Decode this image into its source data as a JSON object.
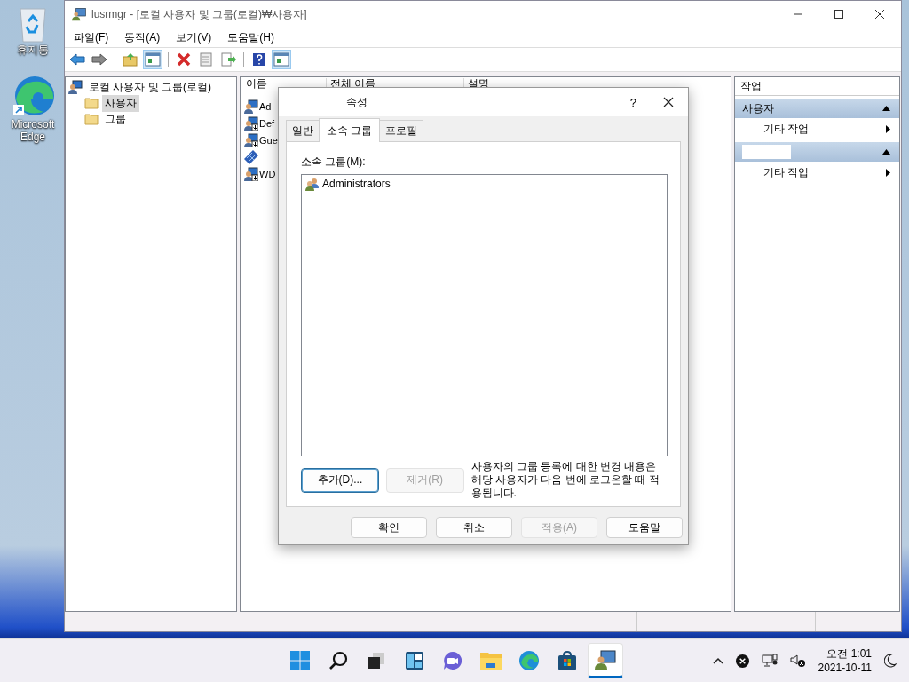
{
  "desktop": {
    "icons": [
      {
        "kind": "recycle",
        "label": "휴지통"
      },
      {
        "kind": "edge",
        "label": "Microsoft Edge"
      }
    ]
  },
  "window": {
    "title": "lusrmgr - [로컬 사용자 및 그룹(로컬)₩사용자]",
    "menu": [
      "파일(F)",
      "동작(A)",
      "보기(V)",
      "도움말(H)"
    ],
    "toolbar": [
      {
        "kind": "back",
        "pressed": false
      },
      {
        "kind": "forward",
        "pressed": false
      },
      {
        "kind": "separator"
      },
      {
        "kind": "up",
        "pressed": false
      },
      {
        "kind": "tree",
        "pressed": true
      },
      {
        "kind": "separator"
      },
      {
        "kind": "delete",
        "pressed": false
      },
      {
        "kind": "properties",
        "pressed": false
      },
      {
        "kind": "export",
        "pressed": false
      },
      {
        "kind": "separator"
      },
      {
        "kind": "help",
        "pressed": false
      },
      {
        "kind": "actionpane",
        "pressed": true
      }
    ],
    "tree": {
      "label": "로컬 사용자 및 그룹(로컬)",
      "children": [
        {
          "label": "사용자",
          "selected": true
        },
        {
          "label": "그룹",
          "selected": false
        }
      ]
    },
    "list": {
      "columns": [
        "이름",
        "전체 이름",
        "설명"
      ],
      "rows": [
        {
          "kind": "user",
          "name": "Ad"
        },
        {
          "kind": "user-down",
          "name": "Def"
        },
        {
          "kind": "user-down",
          "name": "Gue"
        },
        {
          "kind": "pattern"
        },
        {
          "kind": "user-down",
          "name": "WD"
        }
      ]
    },
    "actions": {
      "title": "작업",
      "sections": [
        {
          "title": "사용자",
          "redacted": false,
          "items": [
            "기타 작업"
          ]
        },
        {
          "redacted": true,
          "items": [
            "기타 작업"
          ]
        }
      ]
    }
  },
  "dialog": {
    "title": "속성",
    "help": "?",
    "tabs": [
      {
        "label": "일반",
        "selected": false
      },
      {
        "label": "소속 그룹",
        "selected": true
      },
      {
        "label": "프로필",
        "selected": false
      }
    ],
    "member_label": "소속 그룹(M):",
    "members": [
      "Administrators"
    ],
    "buttons": [
      {
        "label": "추가(D)...",
        "disabled": false,
        "default": true
      },
      {
        "label": "제거(R)",
        "disabled": true,
        "default": false
      }
    ],
    "note": "사용자의 그룹 등록에 대한 변경 내용은 해당 사용자가 다음 번에 로그온할 때 적용됩니다.",
    "footer": [
      {
        "label": "확인",
        "disabled": false
      },
      {
        "label": "취소",
        "disabled": false
      },
      {
        "label": "적용(A)",
        "disabled": true
      },
      {
        "label": "도움말",
        "disabled": false
      }
    ]
  },
  "taskbar": {
    "apps": [
      {
        "kind": "start",
        "active": false
      },
      {
        "kind": "search",
        "active": false
      },
      {
        "kind": "taskview",
        "active": false
      },
      {
        "kind": "widgets",
        "active": false
      },
      {
        "kind": "chat",
        "active": false
      },
      {
        "kind": "explorer",
        "active": false
      },
      {
        "kind": "edge",
        "active": false
      },
      {
        "kind": "store",
        "active": false
      },
      {
        "kind": "users",
        "active": true
      }
    ],
    "time": "오전 1:01",
    "date": "2021-10-11"
  }
}
